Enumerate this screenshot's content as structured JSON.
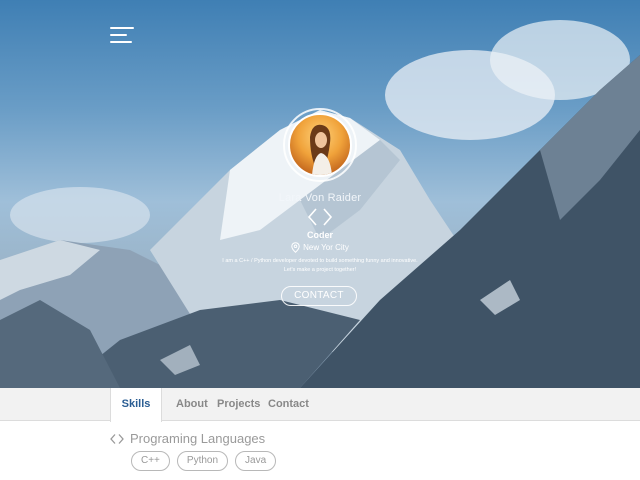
{
  "hero": {
    "name": "Lara Von Raider",
    "role": "Coder",
    "location": "New Yor City",
    "bio": "I am a C++ / Python developer devoted to build something funny and innovative. Let's make a project together!",
    "contact_label": "CONTACT",
    "icons": {
      "menu": "hamburger-menu-icon",
      "role": "code-brackets-icon",
      "location": "map-pin-icon"
    }
  },
  "tabs": [
    {
      "label": "Skills",
      "active": true
    },
    {
      "label": "About",
      "active": false
    },
    {
      "label": "Projects",
      "active": false
    },
    {
      "label": "Contact",
      "active": false
    }
  ],
  "skills": {
    "title": "Programing Languages",
    "icon": "code-brackets-icon",
    "items": [
      "C++",
      "Python",
      "Java"
    ]
  },
  "colors": {
    "accent": "#2a5d93",
    "tabbar": "#f2f2f2",
    "chip_border": "#b8b8b8"
  }
}
